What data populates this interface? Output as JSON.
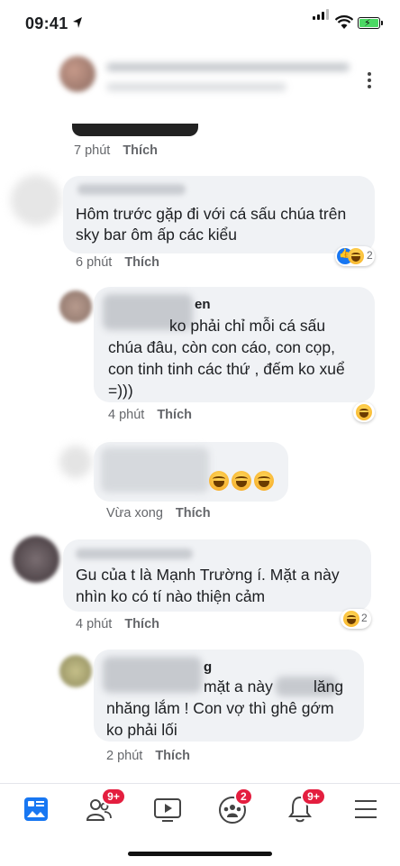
{
  "status_bar": {
    "time": "09:41",
    "location_icon": "location-arrow-icon",
    "signal_icon": "cellular-signal-icon",
    "wifi_icon": "wifi-icon",
    "battery_icon": "battery-charging-icon",
    "battery_color": "#4cd964"
  },
  "header_post": {
    "meta_time": "7 phút",
    "like_label": "Thích"
  },
  "comments": [
    {
      "text_lines": [
        "Hôm trước gặp đi với cá sấu chúa trên",
        "sky bar ôm ấp các kiểu"
      ],
      "time": "6 phút",
      "like_label": "Thích",
      "reaction_count": "2",
      "reactions": [
        "like-icon",
        "haha-icon"
      ]
    },
    {
      "name_suffix": "en",
      "text_lines": [
        "ko phải chỉ mỗi cá sấu",
        "chúa đâu, còn con cáo, con cọp,",
        "con tinh tinh các thứ , đếm ko xuể",
        "=)))"
      ],
      "time": "4 phút",
      "like_label": "Thích",
      "reactions": [
        "haha-icon"
      ]
    },
    {
      "emoji": [
        "laughing-tears-icon",
        "laughing-tears-icon",
        "laughing-tears-icon"
      ],
      "time": "Vừa xong",
      "like_label": "Thích"
    },
    {
      "text_lines": [
        "Gu của t là Mạnh Trường í. Mặt a này",
        "nhìn ko có tí nào thiện cảm"
      ],
      "time": "4 phút",
      "like_label": "Thích",
      "reaction_count": "2",
      "reactions": [
        "haha-icon"
      ]
    },
    {
      "name_suffix": "g",
      "line1_a": "mặt a này",
      "line1_b": "lăng",
      "text_lines": [
        "nhăng lắm ! Con vợ thì ghê gớm",
        "ko phải lối"
      ],
      "time": "2 phút",
      "like_label": "Thích"
    }
  ],
  "nav": {
    "items": [
      {
        "icon": "news-feed-icon",
        "badge": ""
      },
      {
        "icon": "friends-icon",
        "badge": "9+"
      },
      {
        "icon": "watch-video-icon",
        "badge": ""
      },
      {
        "icon": "groups-icon",
        "badge": "2"
      },
      {
        "icon": "notifications-bell-icon",
        "badge": "9+"
      },
      {
        "icon": "menu-icon",
        "badge": ""
      }
    ],
    "accent": "#1877f2",
    "badge_color": "#e41e3f"
  }
}
